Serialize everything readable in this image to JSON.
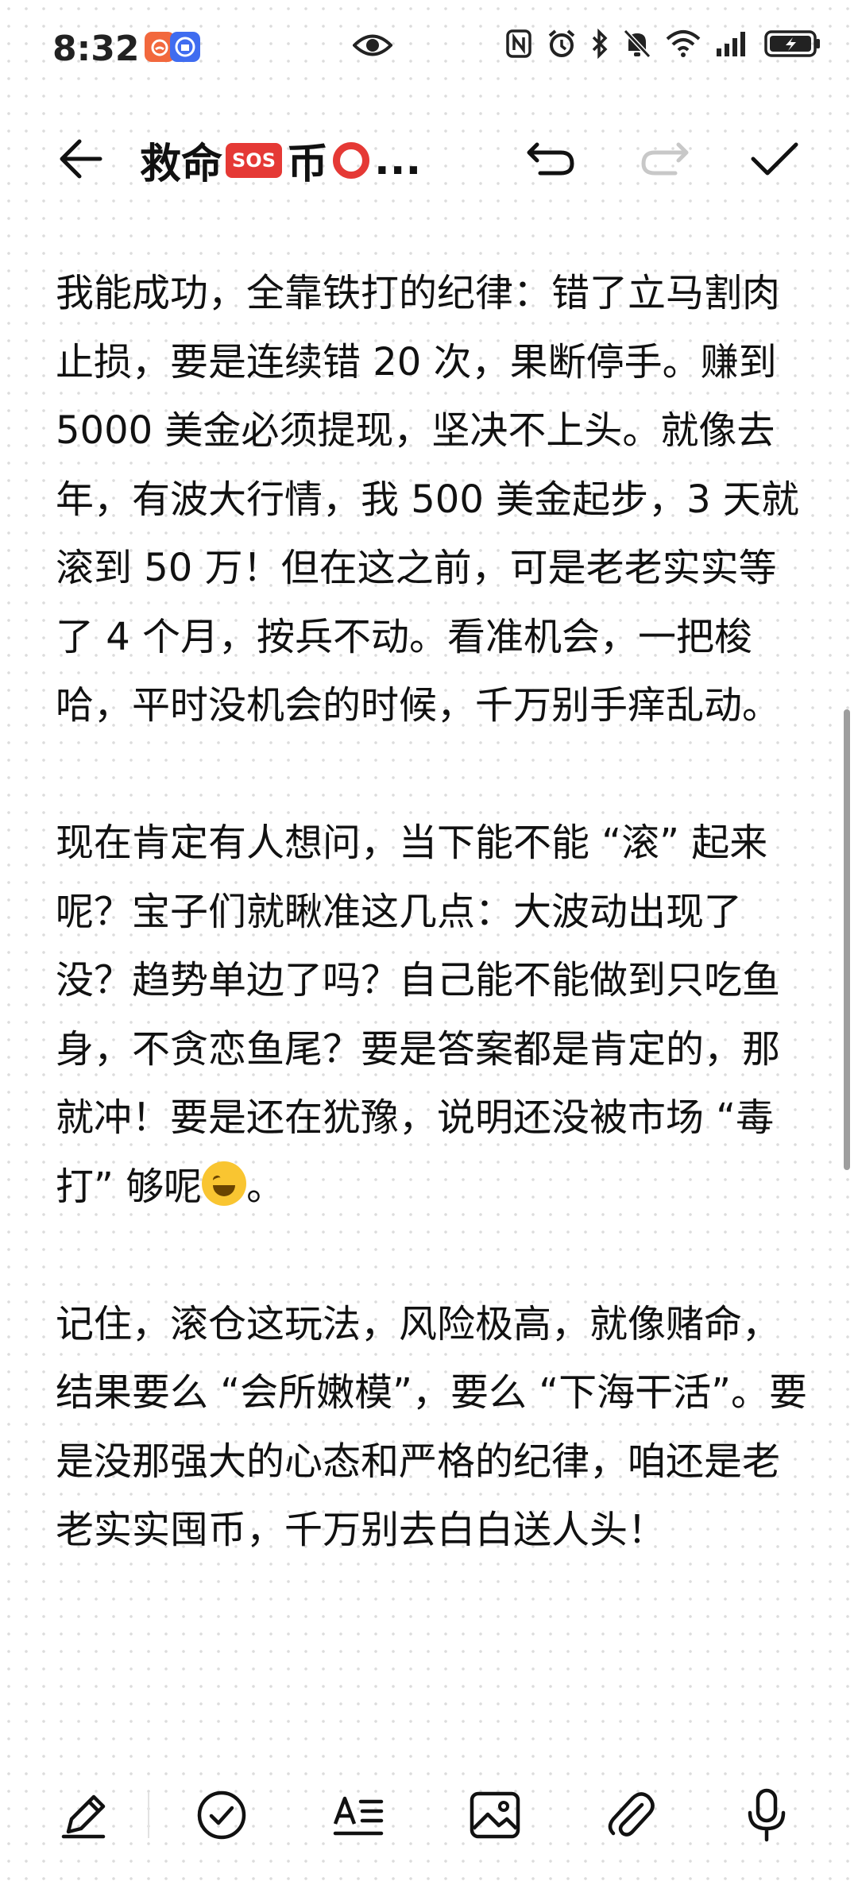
{
  "status_bar": {
    "time": "8:32",
    "icons": [
      "app-notification-icon",
      "app-notification-icon-2",
      "eye-icon",
      "nfc-icon",
      "alarm-icon",
      "bluetooth-icon",
      "mute-icon",
      "wifi-icon",
      "signal-icon",
      "battery-icon"
    ]
  },
  "toolbar": {
    "title_part1": "救命",
    "title_emoji_sos": "SOS",
    "title_part2": "币",
    "title_ellipsis": "..."
  },
  "note": {
    "paragraphs": [
      "我能成功，全靠铁打的纪律：错了立马割肉止损，要是连续错 20 次，果断停手。赚到 5000 美金必须提现，坚决不上头。就像去年，有波大行情，我 500 美金起步，3 天就滚到 50 万！但在这之前，可是老老实实等了 4 个月，按兵不动。看准机会，一把梭哈，平时没机会的时候，千万别手痒乱动。",
      "现在肯定有人想问，当下能不能 “滚” 起来呢？宝子们就瞅准这几点：大波动出现了没？趋势单边了吗？自己能不能做到只吃鱼身，不贪恋鱼尾？要是答案都是肯定的，那就冲！要是还在犹豫，说明还没被市场 “毒打” 够呢",
      "。",
      "记住，滚仓这玩法，风险极高，就像赌命，结果要么 “会所嫩模”，要么 “下海干活”。要是没那强大的心态和严格的纪律，咱还是老老实实囤币，千万别去白白送人头！"
    ]
  },
  "bottom_bar": {
    "tools": [
      "pen-icon",
      "checklist-icon",
      "text-format-icon",
      "image-icon",
      "attachment-icon",
      "microphone-icon"
    ]
  }
}
